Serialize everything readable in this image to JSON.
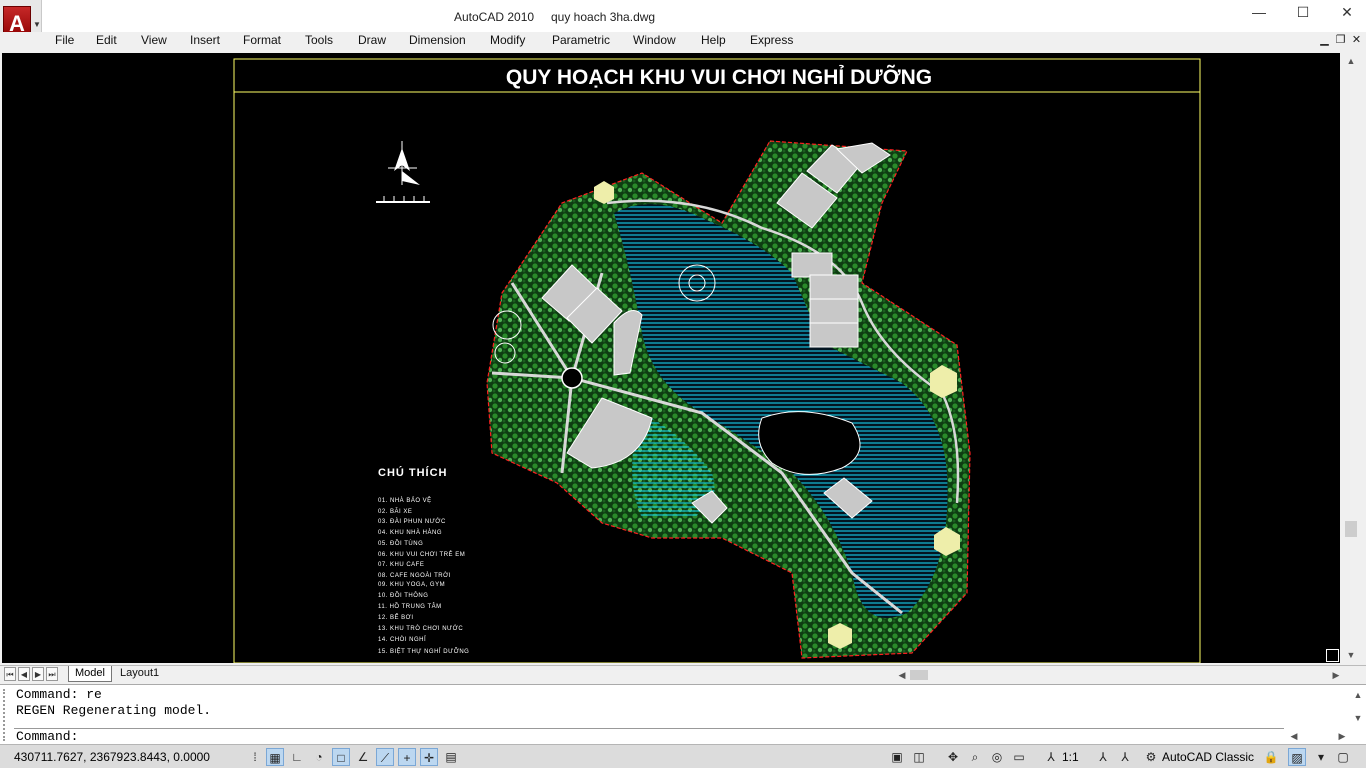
{
  "window": {
    "app_name": "AutoCAD 2010",
    "file_name": "quy hoach 3ha.dwg",
    "app_logo_letter": "A",
    "controls": [
      "—",
      "☐",
      "✕"
    ]
  },
  "menu": [
    "File",
    "Edit",
    "View",
    "Insert",
    "Format",
    "Tools",
    "Draw",
    "Dimension",
    "Modify",
    "Parametric",
    "Window",
    "Help",
    "Express"
  ],
  "drawing": {
    "title": "QUY HOẠCH KHU VUI CHƠI NGHỈ DƯỠNG",
    "legend_title": "CHÚ THÍCH",
    "legend": [
      "01. NHÀ BẢO VỆ",
      "02. BÃI XE",
      "03. ĐÀI PHUN NƯỚC",
      "04. KHU NHÀ HÀNG",
      "05. ĐỒI TÙNG",
      "06. KHU VUI CHƠI TRẺ EM",
      "07. KHU CAFE",
      "08. CAFE NGOÀI TRỜI",
      "09. KHU YOGA, GYM",
      "10. ĐỒI THÔNG",
      "11. HỒ TRUNG TÂM",
      "12. BỂ BƠI",
      "13. KHU TRÒ CHƠI NƯỚC",
      "14. CHÒI NGHỈ",
      "15. BIỆT THỰ NGHỈ DƯỠNG"
    ]
  },
  "tabs": [
    "Model",
    "Layout1"
  ],
  "command": {
    "history": [
      "Command: re",
      "REGEN Regenerating model."
    ],
    "prompt": "Command:"
  },
  "status": {
    "coordinates": "430711.7627, 2367923.8443, 0.0000",
    "annotation_scale": "1:1",
    "workspace": "AutoCAD Classic"
  },
  "colors": {
    "canvas": "#000000",
    "frame": "#ffff66",
    "water": "#19e0ff",
    "vegetation": "#1f7a1f",
    "boundary": "#ff2020"
  }
}
